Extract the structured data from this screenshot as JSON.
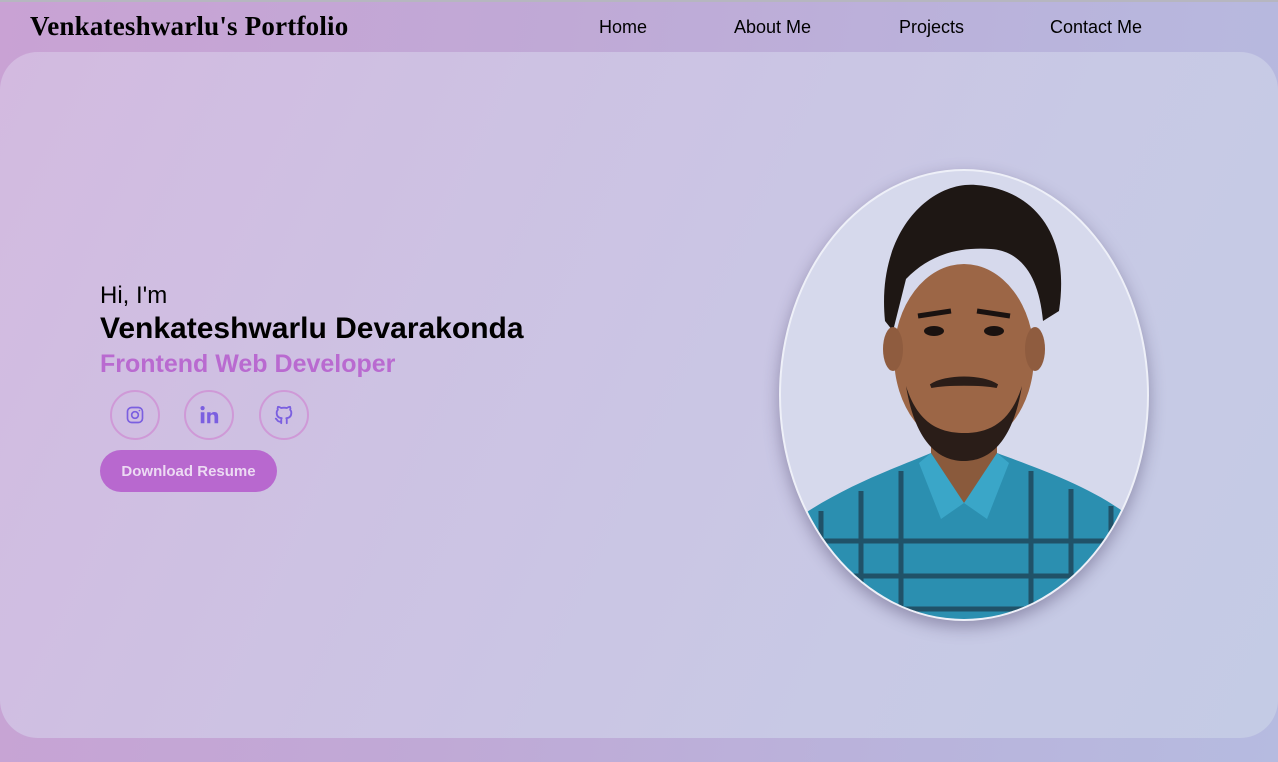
{
  "header": {
    "brand": "Venkateshwarlu's Portfolio",
    "nav": [
      {
        "label": "Home"
      },
      {
        "label": "About Me"
      },
      {
        "label": "Projects"
      },
      {
        "label": "Contact Me"
      }
    ]
  },
  "hero": {
    "greeting": "Hi, I'm",
    "name": "Venkateshwarlu Devarakonda",
    "role": "Frontend Web Developer",
    "socials": [
      {
        "icon": "instagram-icon"
      },
      {
        "icon": "linkedin-icon"
      },
      {
        "icon": "github-icon"
      }
    ],
    "resume_button": "Download Resume",
    "photo_alt": "profile-photo"
  },
  "colors": {
    "accent": "#b96ad0",
    "icon": "#7b5fe0",
    "button_text": "#ecdaf3"
  }
}
